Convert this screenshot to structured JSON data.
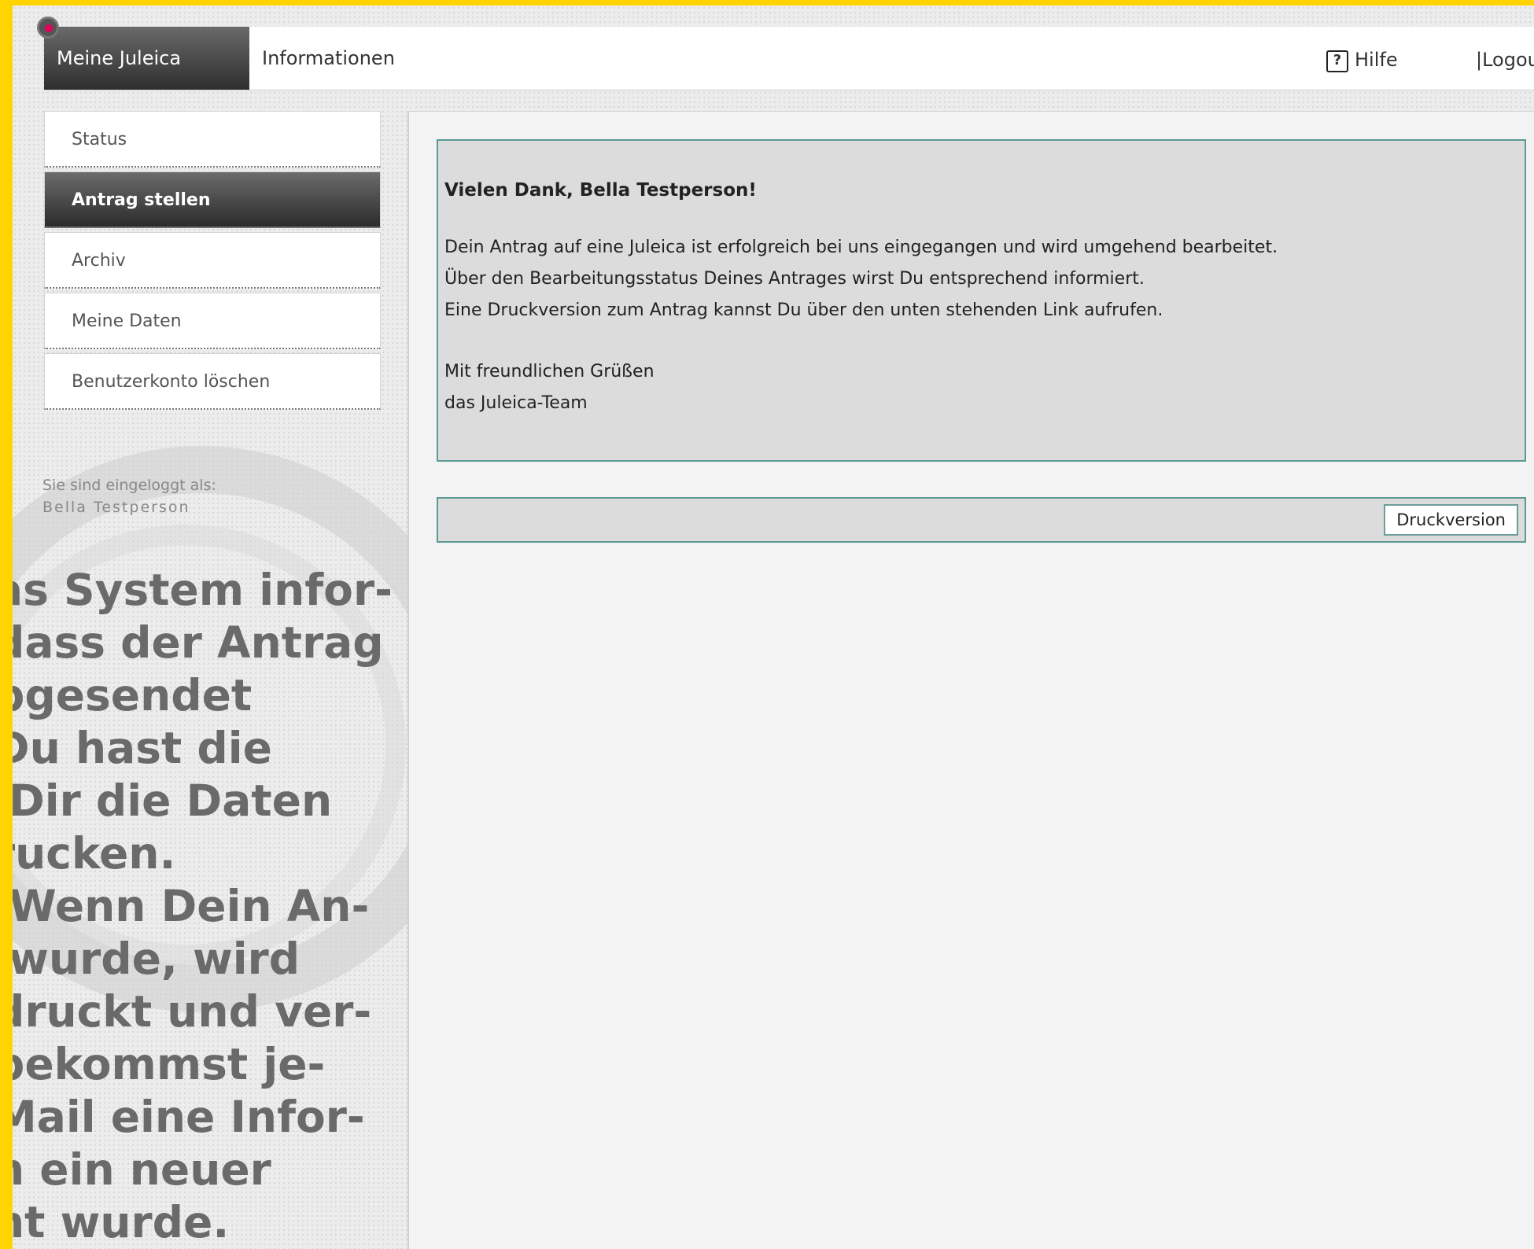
{
  "topbar": {
    "tabs": [
      {
        "label": "Meine Juleica"
      },
      {
        "label": "Informationen"
      }
    ],
    "help_label": "Hilfe",
    "help_icon": "?",
    "logout_label": "|Logout"
  },
  "sidebar": {
    "items": [
      {
        "label": "Status"
      },
      {
        "label": "Antrag stellen"
      },
      {
        "label": "Archiv"
      },
      {
        "label": "Meine Daten"
      },
      {
        "label": "Benutzerkonto löschen"
      }
    ],
    "login_label": "Sie sind eingeloggt als:",
    "login_user": "Bella Testperson"
  },
  "overlay_text": "as System infor-\ndass der Antrag\nbgesendet\nDu hast die\n Dir die Daten\nrucken.\n Wenn Dein An-\n wurde, wird\ndruckt und ver-\nbekommst je-\nMail eine Infor-\nn ein neuer\nht wurde.",
  "message": {
    "title": "Vielen Dank, Bella Testperson!",
    "lines": [
      "Dein Antrag auf eine Juleica ist erfolgreich bei uns eingegangen und wird umgehend bearbeitet.",
      "Über den Bearbeitungsstatus Deines Antrages wirst Du entsprechend informiert.",
      "Eine Druckversion zum Antrag kannst Du über den unten stehenden Link aufrufen."
    ],
    "closing": [
      "Mit freundlichen Grüßen",
      "das Juleica-Team"
    ]
  },
  "print_button_label": "Druckversion"
}
